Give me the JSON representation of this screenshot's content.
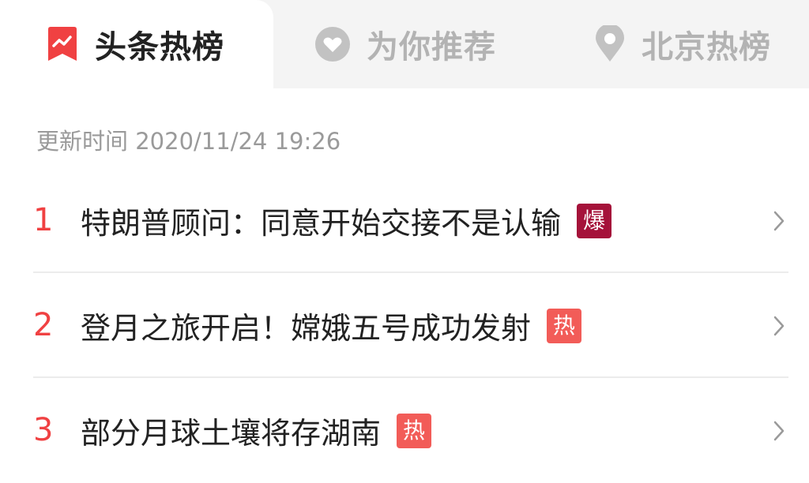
{
  "tabs": [
    {
      "label": "头条热榜",
      "icon": "trending-chart-icon",
      "active": true
    },
    {
      "label": "为你推荐",
      "icon": "heart-icon",
      "active": false
    },
    {
      "label": "北京热榜",
      "icon": "location-pin-icon",
      "active": false
    }
  ],
  "update": {
    "text": "更新时间 2020/11/24 19:26"
  },
  "list": [
    {
      "rank": "1",
      "title": "特朗普顾问：同意开始交接不是认输",
      "badge": "爆",
      "badge_color": "#a5123a"
    },
    {
      "rank": "2",
      "title": "登月之旅开启！嫦娥五号成功发射",
      "badge": "热",
      "badge_color": "#f25c58"
    },
    {
      "rank": "3",
      "title": "部分月球土壤将存湖南",
      "badge": "热",
      "badge_color": "#f25c58"
    }
  ],
  "colors": {
    "accent": "#f04142",
    "tab_bg": "#f4f4f4",
    "muted": "#b3b3b3",
    "divider": "#ececec"
  },
  "icons": {
    "row_chevron": "chevron-right-icon"
  }
}
